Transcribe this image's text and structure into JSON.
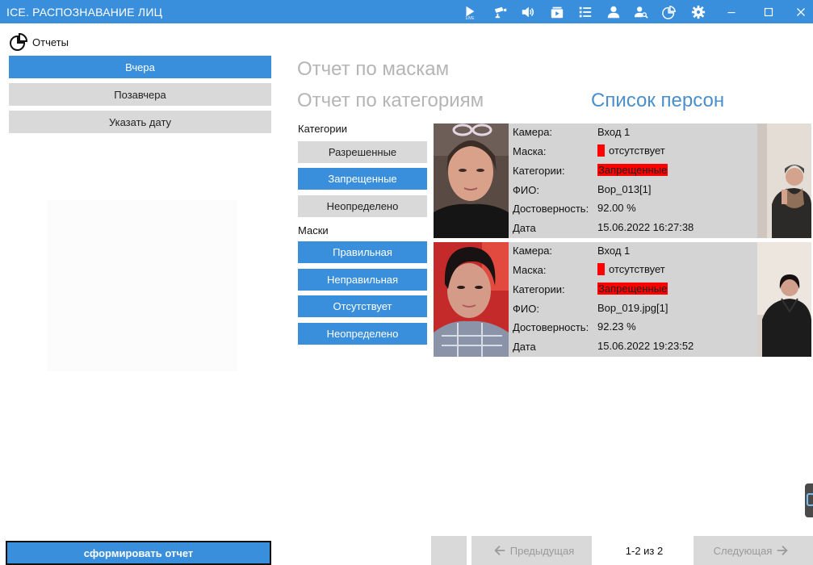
{
  "titlebar": {
    "title": "ICE. РАСПОЗНАВАНИЕ ЛИЦ",
    "live_label": "LIVE",
    "icons": [
      "play-live-icon",
      "camera-icon",
      "speaker-icon",
      "archive-icon",
      "list-icon",
      "person-icon",
      "person-search-icon",
      "chart-icon",
      "gear-icon",
      "minimize-icon",
      "maximize-icon",
      "close-icon"
    ],
    "accent": "#3a8fdc"
  },
  "sidebar": {
    "header": "Отчеты",
    "buttons": [
      {
        "label": "Вчера",
        "active": true
      },
      {
        "label": "Позавчера",
        "active": false
      },
      {
        "label": "Указать дату",
        "active": false
      }
    ],
    "generate_label": "сформировать отчет"
  },
  "nav": {
    "masks_report": "Отчет по маскам",
    "categories_report": "Отчет по категориям",
    "persons_list": "Список персон"
  },
  "filters": {
    "categories_title": "Категории",
    "categories": [
      {
        "label": "Разрешенные",
        "active": false
      },
      {
        "label": "Запрещенные",
        "active": true
      },
      {
        "label": "Неопределено",
        "active": false
      }
    ],
    "masks_title": "Маски",
    "masks": [
      {
        "label": "Правильная",
        "active": true
      },
      {
        "label": "Неправильная",
        "active": true
      },
      {
        "label": "Отсутствует",
        "active": true
      },
      {
        "label": "Неопределено",
        "active": true
      }
    ]
  },
  "fields": {
    "camera": "Камера:",
    "mask": "Маска:",
    "category": "Категории:",
    "name": "ФИО:",
    "confidence": "Достоверность:",
    "date": "Дата"
  },
  "records": [
    {
      "camera": "Вход 1",
      "mask": "отсутствует",
      "category": "Запрещенные",
      "name": "Bop_013[1]",
      "confidence": "92.00 %",
      "date": "15.06.2022 16:27:38"
    },
    {
      "camera": "Вход 1",
      "mask": "отсутствует",
      "category": "Запрещенные",
      "name": "Bop_019.jpg[1]",
      "confidence": "92.23 %",
      "date": "15.06.2022 19:23:52"
    }
  ],
  "pager": {
    "prev": "Предыдущая",
    "status": "1-2 из 2",
    "next": "Следующая"
  },
  "colors": {
    "accent": "#3a8fdc",
    "inactive": "#d9d9d9",
    "card": "#d4d4d4",
    "alert": "#ff0000",
    "link_active": "#4a8ecb",
    "link_inactive": "#b5b5b5"
  }
}
